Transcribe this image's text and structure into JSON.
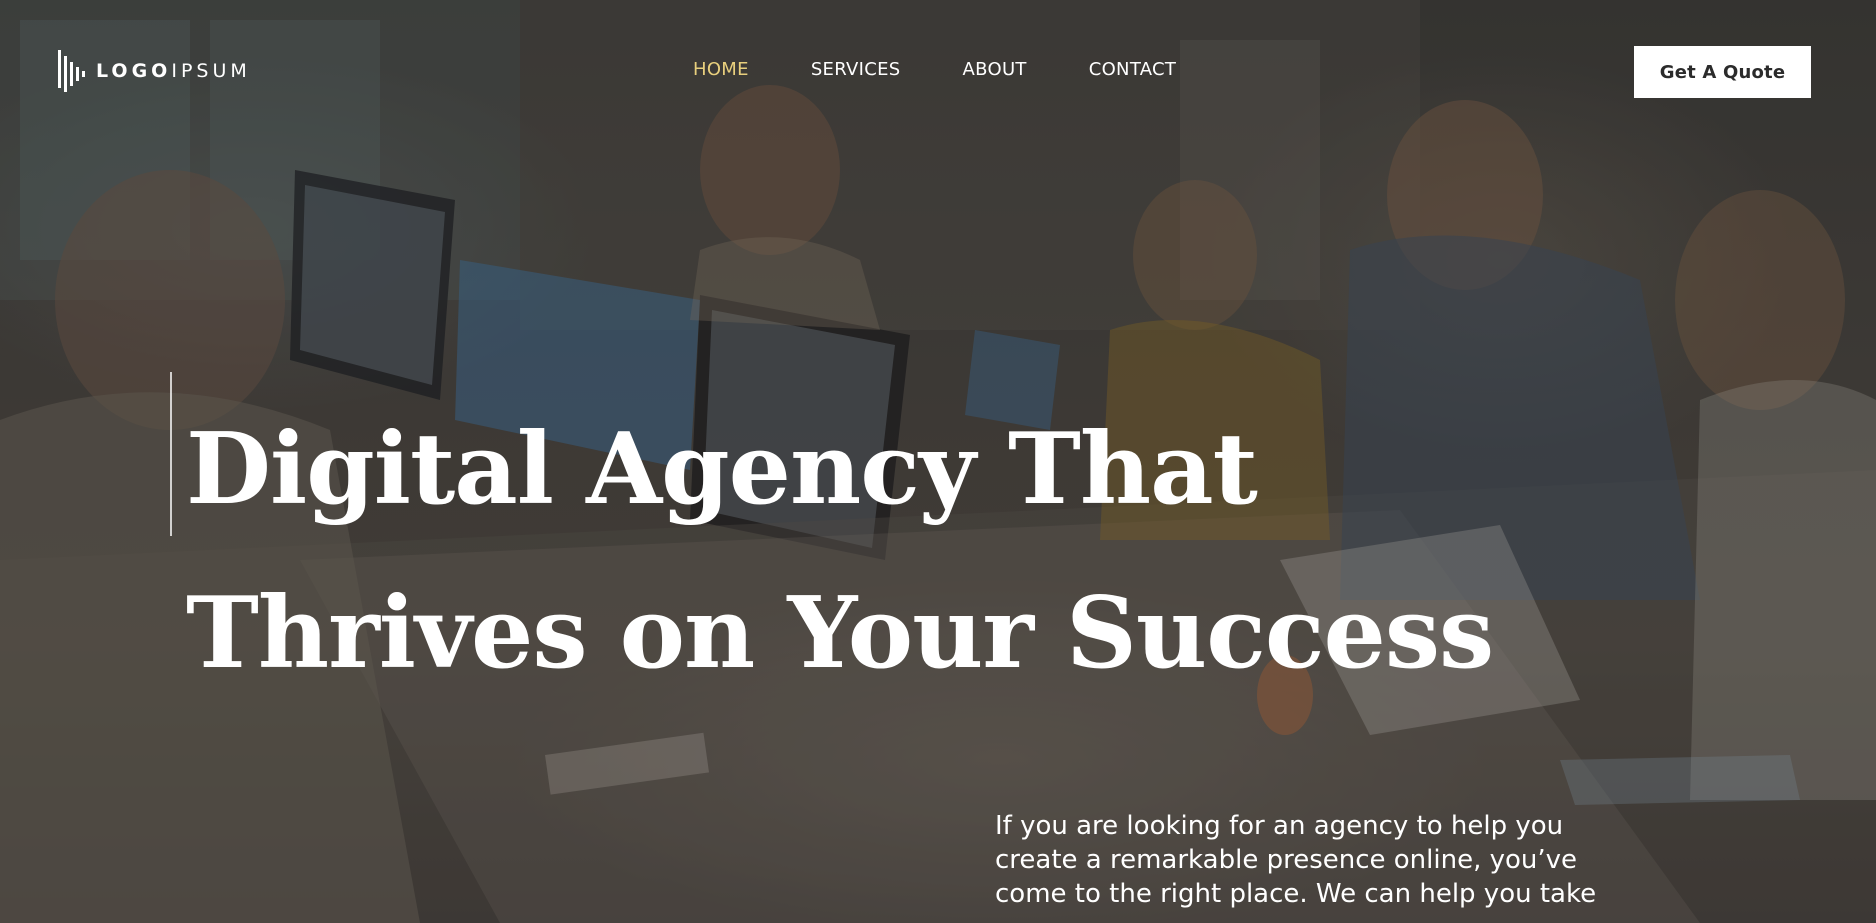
{
  "logo": {
    "bold": "LOGO",
    "light": "IPSUM",
    "icon": "logo-bars-icon"
  },
  "nav": {
    "items": [
      {
        "label": "HOME",
        "active": true
      },
      {
        "label": "SERVICES",
        "active": false
      },
      {
        "label": "ABOUT",
        "active": false
      },
      {
        "label": "CONTACT",
        "active": false
      }
    ],
    "active_color": "#e8cf7d"
  },
  "cta": {
    "label": "Get A Quote"
  },
  "hero": {
    "headline_line1": "Digital Agency That",
    "headline_line2": "Thrives on Your Success",
    "intro": "If you are looking for an agency to help you create a remarkable presence online, you’ve come to the right place. We can help you take"
  },
  "colors": {
    "accent": "#e8cf7d",
    "button_bg": "#ffffff",
    "text": "#ffffff"
  }
}
